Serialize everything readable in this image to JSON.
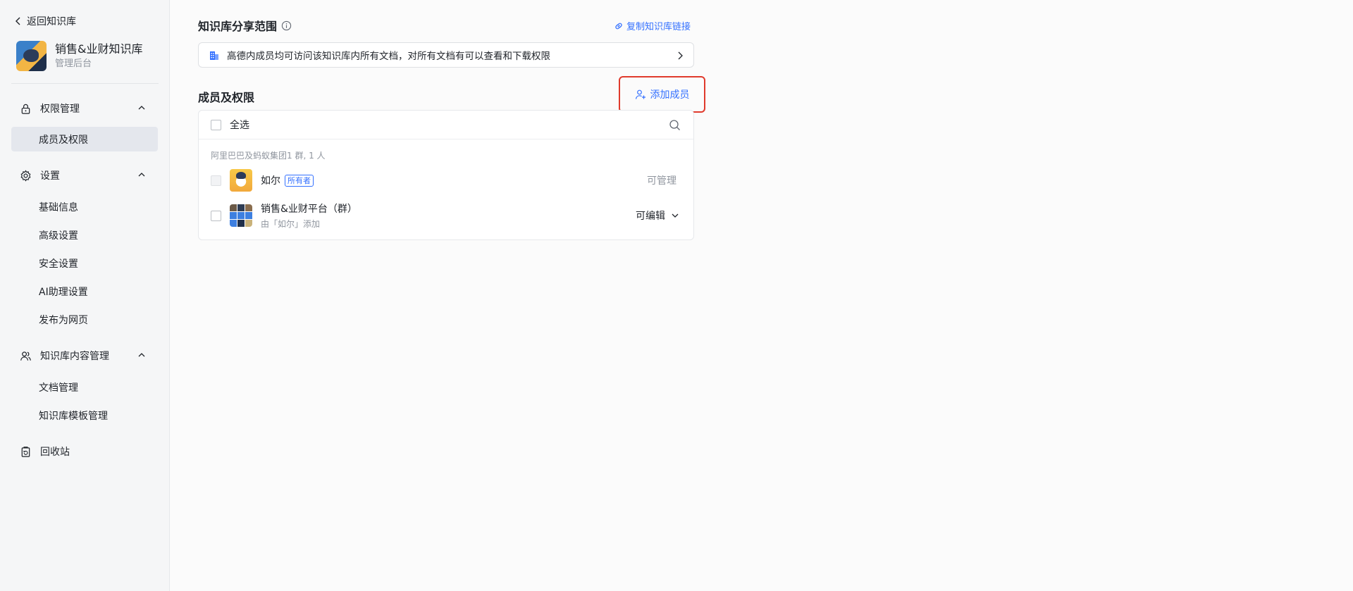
{
  "sidebar": {
    "back_label": "返回知识库",
    "kb_title": "销售&业财知识库",
    "kb_subtitle": "管理后台",
    "groups": [
      {
        "label": "权限管理",
        "items": [
          {
            "label": "成员及权限",
            "active": true
          }
        ]
      },
      {
        "label": "设置",
        "items": [
          {
            "label": "基础信息"
          },
          {
            "label": "高级设置"
          },
          {
            "label": "安全设置"
          },
          {
            "label": "AI助理设置"
          },
          {
            "label": "发布为网页"
          }
        ]
      },
      {
        "label": "知识库内容管理",
        "items": [
          {
            "label": "文档管理"
          },
          {
            "label": "知识库模板管理"
          }
        ]
      }
    ],
    "recycle_label": "回收站"
  },
  "share": {
    "title": "知识库分享范围",
    "copy_link_label": "复制知识库链接",
    "scope_text": "高德内成员均可访问该知识库内所有文档，对所有文档有可以查看和下载权限"
  },
  "members": {
    "title": "成员及权限",
    "add_button_label": "添加成员",
    "select_all_label": "全选",
    "group_caption": "阿里巴巴及蚂蚁集团1 群, 1 人",
    "rows": [
      {
        "name": "如尔",
        "tag": "所有者",
        "permission": "可管理"
      },
      {
        "name": "销售&业财平台（群）",
        "sub": "由「如尔」添加",
        "permission": "可编辑"
      }
    ]
  },
  "colors": {
    "accent": "#3370ff",
    "highlight_border": "#e03a2c",
    "active_nav": "#e4e7ed"
  }
}
